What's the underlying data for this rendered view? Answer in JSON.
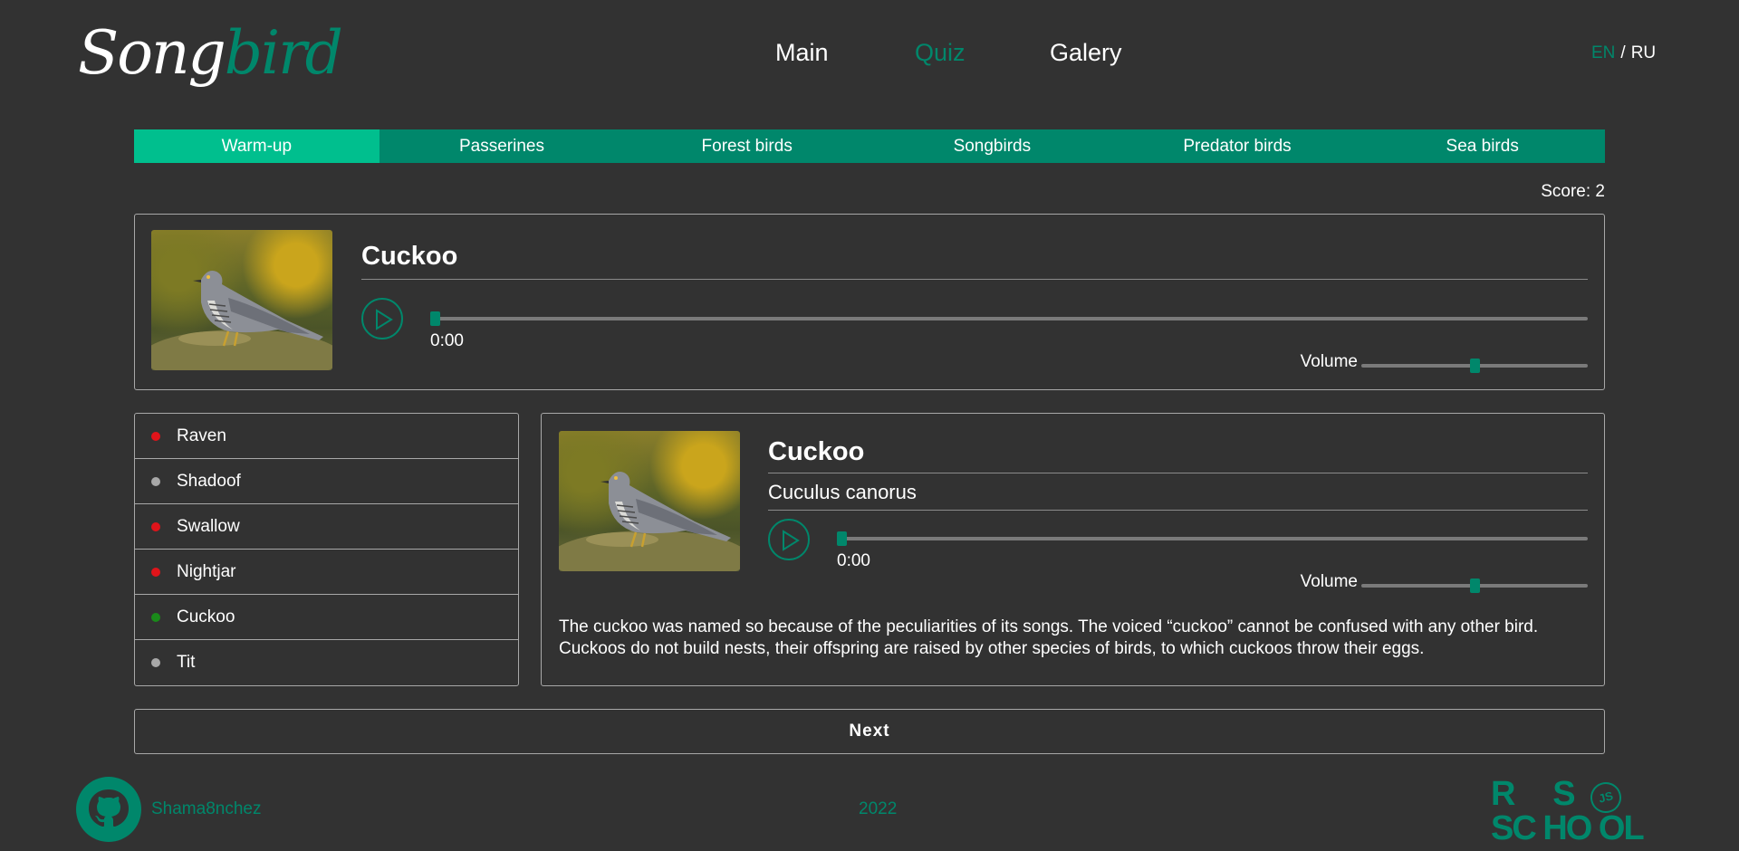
{
  "header": {
    "logo": {
      "part1": "Song",
      "part2": "bird"
    },
    "nav": [
      {
        "label": "Main",
        "active": false
      },
      {
        "label": "Quiz",
        "active": true
      },
      {
        "label": "Galery",
        "active": false
      }
    ],
    "lang": {
      "en": "EN",
      "separator": "/",
      "ru": "RU",
      "active": "EN"
    }
  },
  "colors": {
    "background": "#323232",
    "accent": "#00876b",
    "accent_light": "#00bf8e",
    "correct": "#1a8a1a",
    "wrong": "#e0141a",
    "neutral": "#a8a8a8"
  },
  "tabs": [
    {
      "label": "Warm-up",
      "active": true
    },
    {
      "label": "Passerines",
      "active": false
    },
    {
      "label": "Forest birds",
      "active": false
    },
    {
      "label": "Songbirds",
      "active": false
    },
    {
      "label": "Predator birds",
      "active": false
    },
    {
      "label": "Sea birds",
      "active": false
    }
  ],
  "score": "Score: 2",
  "question": {
    "bird_name": "Cuckoo",
    "player": {
      "time": "0:00",
      "progress": 0,
      "volume_label": "Volume",
      "volume": 0.5
    }
  },
  "answers": [
    {
      "label": "Raven",
      "status": "wrong"
    },
    {
      "label": "Shadoof",
      "status": "neutral"
    },
    {
      "label": "Swallow",
      "status": "wrong"
    },
    {
      "label": "Nightjar",
      "status": "wrong"
    },
    {
      "label": "Cuckoo",
      "status": "correct"
    },
    {
      "label": "Tit",
      "status": "neutral"
    }
  ],
  "details": {
    "name": "Cuckoo",
    "latin": "Cuculus canorus",
    "player": {
      "time": "0:00",
      "progress": 0,
      "volume_label": "Volume",
      "volume": 0.5
    },
    "description": "The cuckoo was named so because of the peculiarities of its songs. The voiced “cuckoo” cannot be confused with any other bird. Cuckoos do not build nests, their offspring are raised by other species of birds, to which cuckoos throw their eggs."
  },
  "next_label": "Next",
  "footer": {
    "github_user": "Shama8nchez",
    "year": "2022",
    "rs_logo": {
      "line1": "R     S",
      "line2": "SC HO OL",
      "badge": "JS"
    }
  }
}
